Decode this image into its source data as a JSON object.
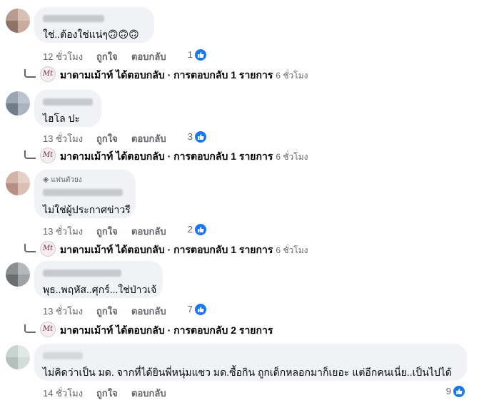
{
  "comments": [
    {
      "text": "ใช่..ต้องใช่แน่ๆ🙃🙃🙃",
      "time": "12 ชั่วโมง",
      "like_label": "ถูกใจ",
      "reply_label": "ตอบกลับ",
      "reactions": "1",
      "reply_summary": "มาดามเม้าท์ ได้ตอบกลับ · การตอบกลับ 1 รายการ",
      "reply_time": "6 ชั่วโมง"
    },
    {
      "text": "ไฮโล ปะ",
      "time": "13 ชั่วโมง",
      "like_label": "ถูกใจ",
      "reply_label": "ตอบกลับ",
      "reactions": "3",
      "reply_summary": "มาดามเม้าท์ ได้ตอบกลับ · การตอบกลับ 1 รายการ",
      "reply_time": "6 ชั่วโมง"
    },
    {
      "badge": "แฟนตัวยง",
      "text": "ไม่ใช่ผู้ประกาศข่าวรี",
      "time": "13 ชั่วโมง",
      "like_label": "ถูกใจ",
      "reply_label": "ตอบกลับ",
      "reactions": "2",
      "reply_summary": "มาดามเม้าท์ ได้ตอบกลับ · การตอบกลับ 1 รายการ",
      "reply_time": "6 ชั่วโมง"
    },
    {
      "text": "พุธ..พฤหัส..ศุกร์...ใช่ป่าวเจ้",
      "time": "13 ชั่วโมง",
      "like_label": "ถูกใจ",
      "reply_label": "ตอบกลับ",
      "reactions": "7",
      "reply_summary": "มาดามเม้าท์ ได้ตอบกลับ · การตอบกลับ 2 รายการ",
      "reply_time": ""
    },
    {
      "text": "ไม่คิดว่าเป็น มด. จากที่ได้ยินพี่หนุ่มแซว มด.ซื้อกิน ถูกเด็กหลอกมาก็เยอะ แต่อีกคนเนี่ย..เป็นไปได้",
      "time": "14 ชั่วโมง",
      "like_label": "ถูกใจ",
      "reply_label": "ตอบกลับ",
      "reactions": "9"
    }
  ],
  "reply_avatar_logo": "Mt",
  "icons": {
    "reaction": "like-thumb-icon",
    "reply_thread": "reply-arrow-icon"
  },
  "colors": {
    "bubble": "#f0f2f5",
    "meta_text": "#65676b",
    "like_blue": "#1877f2"
  }
}
